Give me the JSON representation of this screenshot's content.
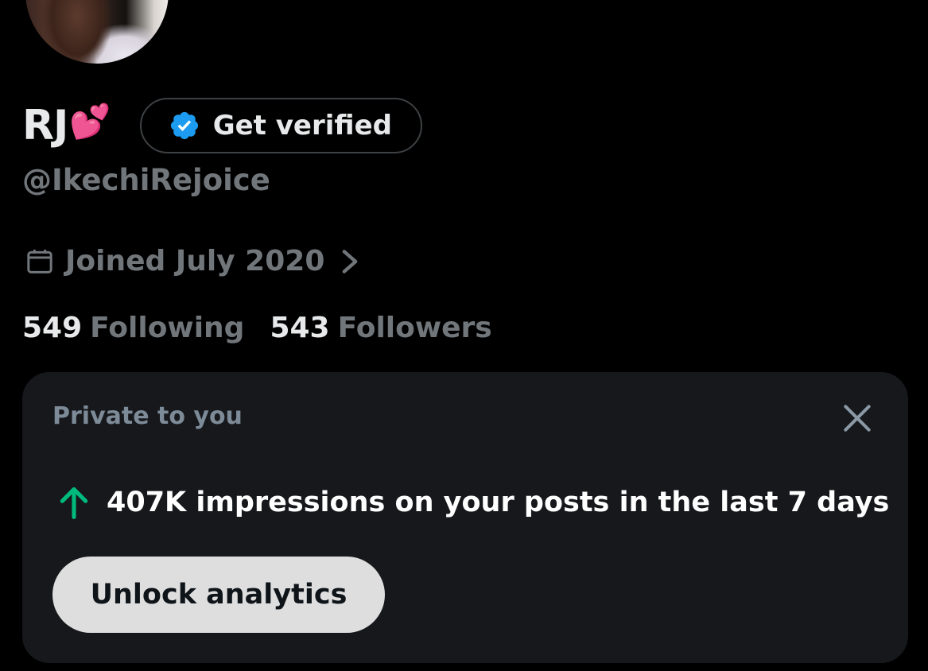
{
  "profile": {
    "display_name": "RJ",
    "name_emoji": "💕",
    "handle": "@IkechiRejoice",
    "verify_label": "Get verified",
    "joined": "Joined July 2020"
  },
  "stats": {
    "following_count": "549",
    "following_label": "Following",
    "followers_count": "543",
    "followers_label": "Followers"
  },
  "analytics_card": {
    "caption": "Private to you",
    "impressions_text": "407K impressions on your posts in the last 7 days",
    "unlock_label": "Unlock analytics"
  },
  "colors": {
    "background": "#000000",
    "card_bg": "#16181c",
    "muted_text": "#71767b",
    "verified_blue": "#1d9bf0",
    "trend_green": "#00ba7c",
    "button_bg": "#dedede"
  },
  "icons": {
    "verified": "verified-badge-icon",
    "calendar": "calendar-icon",
    "chevron": "chevron-right-icon",
    "close": "close-icon",
    "trend": "arrow-up-icon"
  }
}
